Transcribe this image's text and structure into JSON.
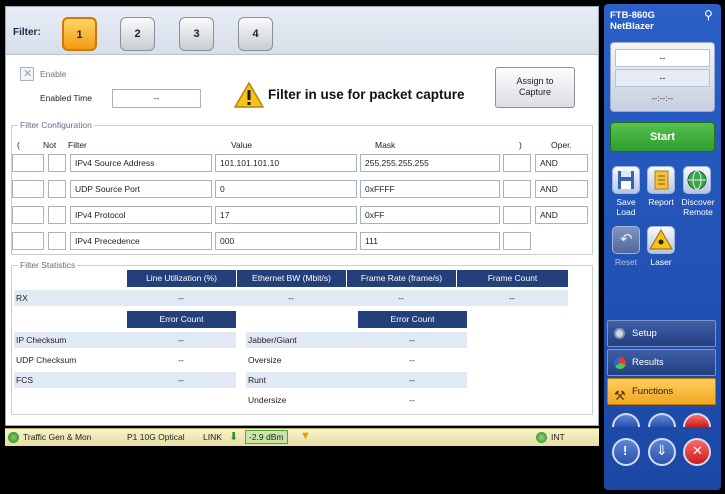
{
  "filter_bar": {
    "label": "Filter:",
    "tabs": [
      "1",
      "2",
      "3",
      "4"
    ],
    "active_tab": "1"
  },
  "header": {
    "enable_label": "Enable",
    "enabled_time_label": "Enabled Time",
    "enabled_time_value": "--",
    "warning_text": "Filter in use for packet capture",
    "assign_button": "Assign to Capture"
  },
  "filter_config": {
    "title": "Filter Configuration",
    "columns": {
      "open_paren": "(",
      "not": "Not",
      "filter": "Filter",
      "value": "Value",
      "mask": "Mask",
      "close_paren": ")",
      "oper": "Oper."
    },
    "rows": [
      {
        "filter": "IPv4 Source Address",
        "value": "101.101.101.10",
        "mask": "255.255.255.255",
        "oper": "AND"
      },
      {
        "filter": "UDP Source Port",
        "value": "0",
        "mask": "0xFFFF",
        "oper": "AND"
      },
      {
        "filter": "IPv4 Protocol",
        "value": "17",
        "mask": "0xFF",
        "oper": "AND"
      },
      {
        "filter": "IPv4 Precedence",
        "value": "000",
        "mask": "111",
        "oper": ""
      }
    ]
  },
  "filter_stats": {
    "title": "Filter Statistics",
    "columns": [
      "Line Utilization (%)",
      "Ethernet BW (Mbit/s)",
      "Frame Rate (frame/s)",
      "Frame Count"
    ],
    "rx_label": "RX",
    "rx_values": [
      "--",
      "--",
      "--",
      "--"
    ],
    "error_count_label": "Error Count",
    "left_errors": [
      {
        "label": "IP Checksum",
        "value": "--"
      },
      {
        "label": "UDP Checksum",
        "value": "--"
      },
      {
        "label": "FCS",
        "value": "--"
      }
    ],
    "right_errors": [
      {
        "label": "Jabber/Giant",
        "value": "--"
      },
      {
        "label": "Oversize",
        "value": "--"
      },
      {
        "label": "Runt",
        "value": "--"
      },
      {
        "label": "Undersize",
        "value": "--"
      }
    ]
  },
  "status_bar": {
    "app": "Traffic Gen & Mon",
    "port": "P1 10G Optical",
    "link": "LINK",
    "power": "-2.9 dBm",
    "clock": "INT"
  },
  "right_panel": {
    "model": "FTB-860G",
    "product": "NetBlazer",
    "display_top": "--",
    "display_mid": "--",
    "timer": "--:--:--",
    "start_button": "Start",
    "save_load": [
      "Save",
      "Load"
    ],
    "report": "Report",
    "discover": [
      "Discover",
      "Remote"
    ],
    "reset": "Reset",
    "laser": "Laser",
    "menu": [
      "Setup",
      "Results",
      "Functions"
    ],
    "active_menu": "Functions"
  },
  "colors": {
    "active_tab": "#f29a12",
    "table_header": "#23407a",
    "start_green": "#2e9c2e",
    "panel_blue": "#1b47a4",
    "functions_orange": "#f2a623"
  }
}
